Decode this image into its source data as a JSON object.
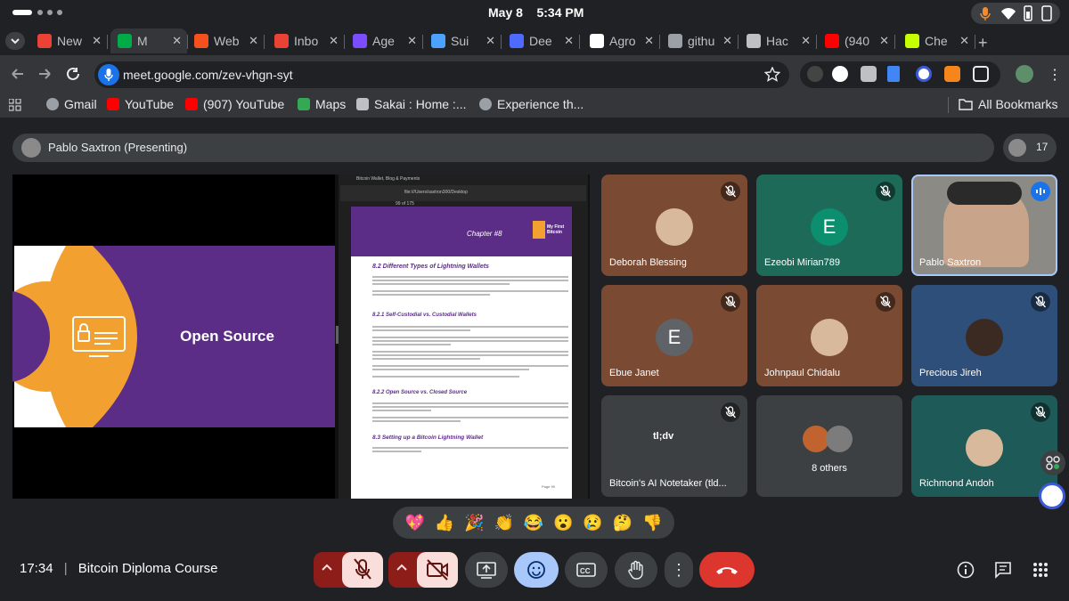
{
  "status_bar": {
    "date": "May 8",
    "time": "5:34 PM"
  },
  "tabs": [
    {
      "label": "New",
      "icon": "gmail-icon",
      "color": "#ea4335"
    },
    {
      "label": "M",
      "icon": "meet-icon",
      "color": "#00ac47"
    },
    {
      "label": "Web",
      "icon": "web-icon",
      "color": "#f4511e"
    },
    {
      "label": "Inbo",
      "icon": "inbox-icon",
      "color": "#ea4335"
    },
    {
      "label": "Age",
      "icon": "agent-icon",
      "color": "#7c4dff"
    },
    {
      "label": "Sui",
      "icon": "sui-icon",
      "color": "#4da2ff"
    },
    {
      "label": "Dee",
      "icon": "deep-icon",
      "color": "#4d6bfe"
    },
    {
      "label": "Agro",
      "icon": "github-icon",
      "color": "#ffffff"
    },
    {
      "label": "githu",
      "icon": "globe-icon",
      "color": "#9aa0a6"
    },
    {
      "label": "Hac",
      "icon": "hac-icon",
      "color": "#bdc1c6"
    },
    {
      "label": "(940",
      "icon": "youtube-icon",
      "color": "#ff0000"
    },
    {
      "label": "Che",
      "icon": "che-icon",
      "color": "#c6ff00"
    }
  ],
  "address_bar": {
    "url": "meet.google.com/zev-vhgn-syt"
  },
  "bookmarks": [
    {
      "label": "Gmail",
      "icon": "globe-icon"
    },
    {
      "label": "YouTube",
      "icon": "youtube-icon"
    },
    {
      "label": "(907) YouTube",
      "icon": "youtube-icon"
    },
    {
      "label": "Maps",
      "icon": "maps-icon"
    },
    {
      "label": "Sakai : Home :...",
      "icon": "sakai-icon"
    },
    {
      "label": "Experience th...",
      "icon": "globe-icon"
    }
  ],
  "all_bookmarks": "All Bookmarks",
  "meet": {
    "presenting_label": "Pablo Saxtron (Presenting)",
    "participant_count": "17",
    "slide_title": "Open Source",
    "document": {
      "window_title": "Bitcoin Wallet, Blog & Payments",
      "url_text": "file:///Users/saxtron300/Desktop",
      "page": "99",
      "page_total": "of 175",
      "chapter": "Chapter #8",
      "logo_text": "My First Bitcoin",
      "heading1": "8.2 Different Types of Lightning Wallets",
      "heading2": "8.2.1 Self-Custodial vs. Custodial Wallets",
      "heading3": "8.2.2 Open Source vs. Closed Source",
      "heading4": "8.3  Setting up a Bitcoin Lightning Wallet",
      "page_footer": "Page 99"
    },
    "participants": [
      {
        "name": "Deborah Blessing",
        "initial": "",
        "bg": "#7a4a33",
        "muted": true
      },
      {
        "name": "Ezeobi Mirian789",
        "initial": "E",
        "bg": "#1e6a58",
        "muted": true
      },
      {
        "name": "Pablo Saxtron",
        "initial": "",
        "bg": "#8c8a84",
        "muted": false,
        "speaking": true
      },
      {
        "name": "Ebue Janet",
        "initial": "E",
        "bg": "#7a4a33",
        "muted": true
      },
      {
        "name": "Johnpaul Chidalu",
        "initial": "",
        "bg": "#7a4a33",
        "muted": true
      },
      {
        "name": "Precious Jireh",
        "initial": "",
        "bg": "#2e4f7a",
        "muted": true
      },
      {
        "name": "Bitcoin's AI Notetaker (tld...",
        "initial": "",
        "bg": "#3c4043",
        "muted": true,
        "tldv_text": "tl;dv"
      },
      {
        "name": "8 others",
        "initial": "",
        "bg": "#3c4043",
        "muted": false
      },
      {
        "name": "Richmond Andoh",
        "initial": "",
        "bg": "#1e5a58",
        "muted": true
      }
    ],
    "reactions": [
      "💖",
      "👍",
      "🎉",
      "👏",
      "😂",
      "😮",
      "😢",
      "🤔",
      "👎"
    ],
    "bottom": {
      "time": "17:34",
      "meeting_name": "Bitcoin Diploma Course"
    },
    "colors": {
      "slide_purple": "#6a3a96",
      "slide_orange": "#f2a02f",
      "danger_red": "#ea4335",
      "mic_off_bg": "#f9dedc",
      "active_blue": "#a8c7fa"
    }
  }
}
